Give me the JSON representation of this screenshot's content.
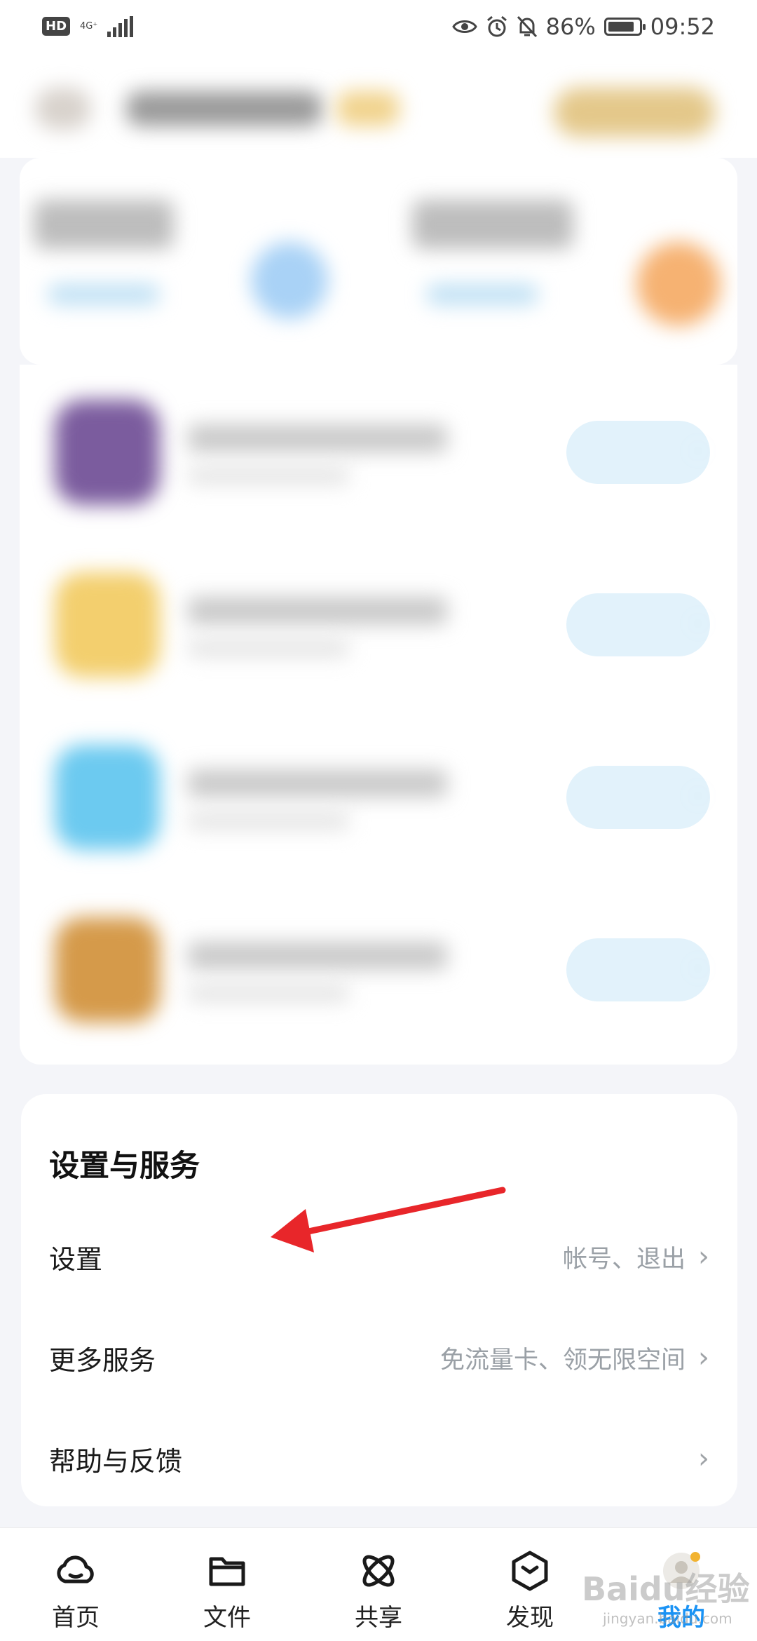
{
  "status_bar": {
    "hd": "HD",
    "network": "4G⁺",
    "battery": "86%",
    "battery_level": 0.86,
    "time": "09:52"
  },
  "settings": {
    "title": "设置与服务",
    "rows": [
      {
        "label": "设置",
        "sub": "帐号、退出"
      },
      {
        "label": "更多服务",
        "sub": "免流量卡、领无限空间"
      },
      {
        "label": "帮助与反馈",
        "sub": ""
      }
    ]
  },
  "bottom_nav": {
    "items": [
      {
        "label": "首页",
        "icon": "cloud-icon"
      },
      {
        "label": "文件",
        "icon": "folder-icon"
      },
      {
        "label": "共享",
        "icon": "atom-icon"
      },
      {
        "label": "发现",
        "icon": "cube-icon"
      },
      {
        "label": "我的",
        "icon": "avatar-icon",
        "active": true
      }
    ]
  },
  "colors": {
    "accent": "#1a93f5",
    "annotation_arrow": "#e8262a"
  },
  "watermark": {
    "text": "Baidu经验",
    "sub": "jingyan.baidu.com"
  }
}
